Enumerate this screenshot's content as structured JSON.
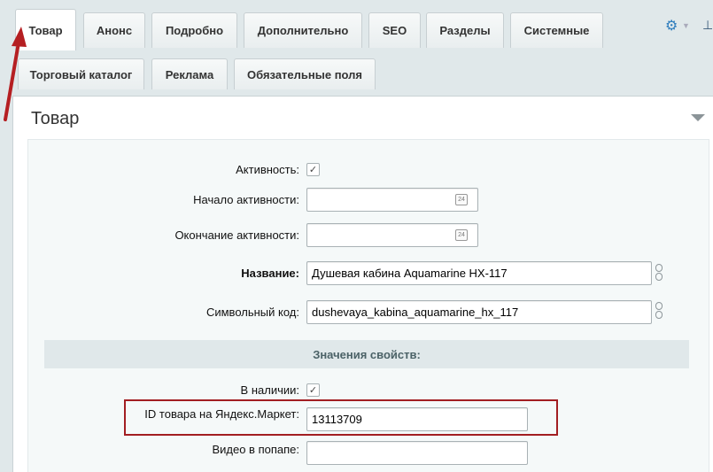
{
  "tabs_row1": [
    {
      "label": "Товар",
      "active": true
    },
    {
      "label": "Анонс",
      "active": false
    },
    {
      "label": "Подробно",
      "active": false
    },
    {
      "label": "Дополнительно",
      "active": false
    },
    {
      "label": "SEO",
      "active": false
    },
    {
      "label": "Разделы",
      "active": false
    },
    {
      "label": "Системные",
      "active": false
    }
  ],
  "tabs_row2": [
    {
      "label": "Торговый каталог"
    },
    {
      "label": "Реклама"
    },
    {
      "label": "Обязательные поля"
    }
  ],
  "toolbar": {
    "gear_icon": "gear-icon",
    "pin_icon": "pin-icon"
  },
  "panel": {
    "title": "Товар"
  },
  "fields": {
    "active": {
      "label": "Активность:",
      "checked": true
    },
    "active_from": {
      "label": "Начало активности:",
      "value": ""
    },
    "active_to": {
      "label": "Окончание активности:",
      "value": ""
    },
    "name": {
      "label": "Название:",
      "value": "Душевая кабина Aquamarine HX-117"
    },
    "code": {
      "label": "Символьный код:",
      "value": "dushevaya_kabina_aquamarine_hx_117"
    }
  },
  "properties": {
    "heading": "Значения свойств:",
    "in_stock": {
      "label": "В наличии:",
      "checked": true
    },
    "yandex_id": {
      "label": "ID товара на Яндекс.Маркет:",
      "value": "13113709"
    },
    "video_popup": {
      "label": "Видео в попапе:",
      "value": ""
    }
  },
  "calendar_glyph": "24",
  "colors": {
    "accent": "#2f7dbd",
    "highlight": "#a21e22",
    "background": "#e0e8ea"
  }
}
